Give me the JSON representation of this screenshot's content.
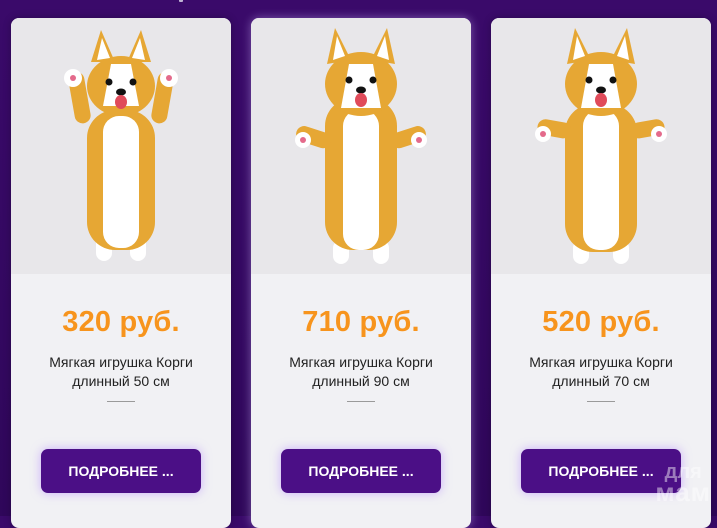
{
  "products": [
    {
      "price": "320 руб.",
      "name": "Мягкая игрушка Корги длинный 50 см",
      "button": "ПОДРОБНЕЕ ...",
      "image": "corgi-plush-50"
    },
    {
      "price": "710 руб.",
      "name": "Мягкая игрушка Корги длинный 90 см",
      "button": "ПОДРОБНЕЕ ...",
      "image": "corgi-plush-90"
    },
    {
      "price": "520 руб.",
      "name": "Мягкая игрушка Корги длинный 70 см",
      "button": "ПОДРОБНЕЕ ...",
      "image": "corgi-plush-70"
    }
  ],
  "watermark": {
    "line1": "для",
    "line2": "мам"
  },
  "colors": {
    "background": "#3a0a6a",
    "price": "#f7941d",
    "button": "#4b0f86",
    "card": "#f1f1f4"
  }
}
